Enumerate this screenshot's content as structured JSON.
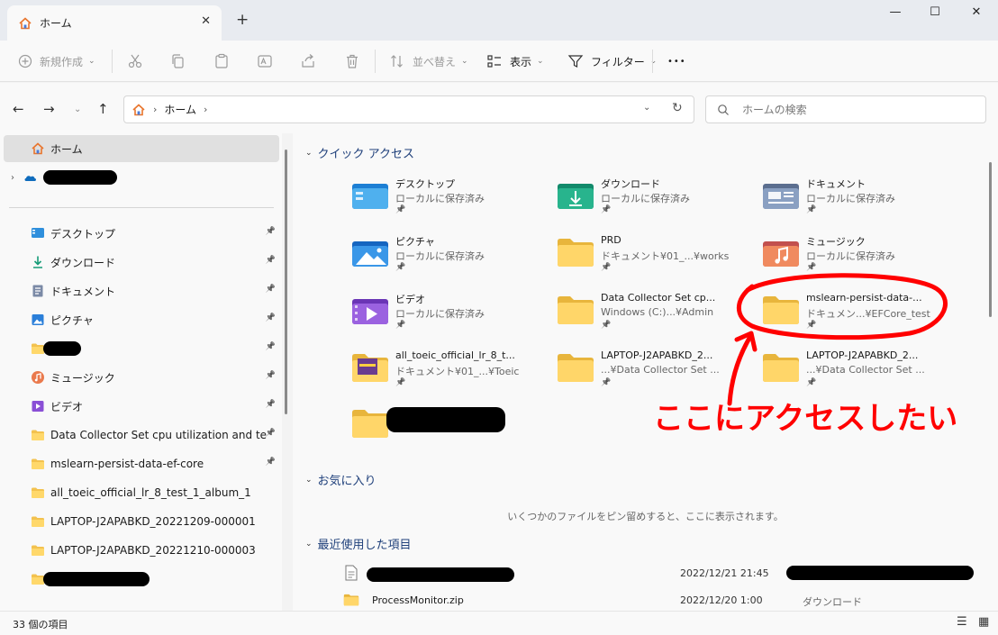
{
  "window": {
    "tab_title": "ホーム",
    "tab_close": "✕",
    "new_tab": "+",
    "minimize": "—",
    "maximize": "☐",
    "close": "✕"
  },
  "toolbar": {
    "new": "新規作成",
    "sort": "並べ替え",
    "view": "表示",
    "filter": "フィルター",
    "more": "•••"
  },
  "address": {
    "crumb": "ホーム",
    "search_placeholder": "ホームの検索"
  },
  "sidebar": {
    "home": "ホーム",
    "pinned": [
      {
        "label": "デスクトップ",
        "icon": "desktop-icon"
      },
      {
        "label": "ダウンロード",
        "icon": "download-icon"
      },
      {
        "label": "ドキュメント",
        "icon": "document-icon"
      },
      {
        "label": "ピクチャ",
        "icon": "pictures-icon"
      },
      {
        "label": "",
        "icon": "folder-icon"
      },
      {
        "label": "ミュージック",
        "icon": "music-icon"
      },
      {
        "label": "ビデオ",
        "icon": "video-icon"
      },
      {
        "label": "Data Collector Set cpu utilization and tempert",
        "icon": "folder-icon"
      },
      {
        "label": "mslearn-persist-data-ef-core",
        "icon": "folder-icon"
      },
      {
        "label": "all_toeic_official_lr_8_test_1_album_1",
        "icon": "folder-icon"
      },
      {
        "label": "LAPTOP-J2APABKD_20221209-000001",
        "icon": "folder-icon"
      },
      {
        "label": "LAPTOP-J2APABKD_20221210-000003",
        "icon": "folder-icon"
      },
      {
        "label": "",
        "icon": "folder-icon"
      }
    ]
  },
  "quick_access": {
    "title": "クイック アクセス",
    "items": [
      {
        "name": "デスクトップ",
        "sub": "ローカルに保存済み",
        "icon": "desktop-folder-icon"
      },
      {
        "name": "ダウンロード",
        "sub": "ローカルに保存済み",
        "icon": "download-folder-icon"
      },
      {
        "name": "ドキュメント",
        "sub": "ローカルに保存済み",
        "icon": "documents-folder-icon"
      },
      {
        "name": "ピクチャ",
        "sub": "ローカルに保存済み",
        "icon": "pictures-folder-icon"
      },
      {
        "name": "PRD",
        "sub": "ドキュメント¥01_...¥works",
        "icon": "folder-icon"
      },
      {
        "name": "ミュージック",
        "sub": "ローカルに保存済み",
        "icon": "music-folder-icon"
      },
      {
        "name": "ビデオ",
        "sub": "ローカルに保存済み",
        "icon": "video-folder-icon"
      },
      {
        "name": "Data Collector Set cp...",
        "sub": "Windows (C:)...¥Admin",
        "icon": "folder-icon"
      },
      {
        "name": "mslearn-persist-data-...",
        "sub": "ドキュメン...¥EFCore_test",
        "icon": "folder-icon"
      },
      {
        "name": "all_toeic_official_lr_8_t...",
        "sub": "ドキュメント¥01_...¥Toeic",
        "icon": "album-folder-icon"
      },
      {
        "name": "LAPTOP-J2APABKD_2...",
        "sub": "...¥Data Collector Set ...",
        "icon": "folder-icon"
      },
      {
        "name": "LAPTOP-J2APABKD_2...",
        "sub": "...¥Data Collector Set ...",
        "icon": "folder-icon"
      },
      {
        "name": "",
        "sub": "",
        "icon": "folder-icon"
      }
    ]
  },
  "favorites": {
    "title": "お気に入り",
    "empty": "いくつかのファイルをピン留めすると、ここに表示されます。"
  },
  "recent": {
    "title": "最近使用した項目",
    "rows": [
      {
        "name": "",
        "date": "2022/12/21 21:45",
        "location": ""
      },
      {
        "name": "ProcessMonitor.zip",
        "date": "2022/12/20 1:00",
        "location": "ダウンロード"
      }
    ]
  },
  "status": {
    "count": "33 個の項目"
  },
  "annotation": {
    "text": "ここにアクセスしたい",
    "color": "#ff0000"
  }
}
